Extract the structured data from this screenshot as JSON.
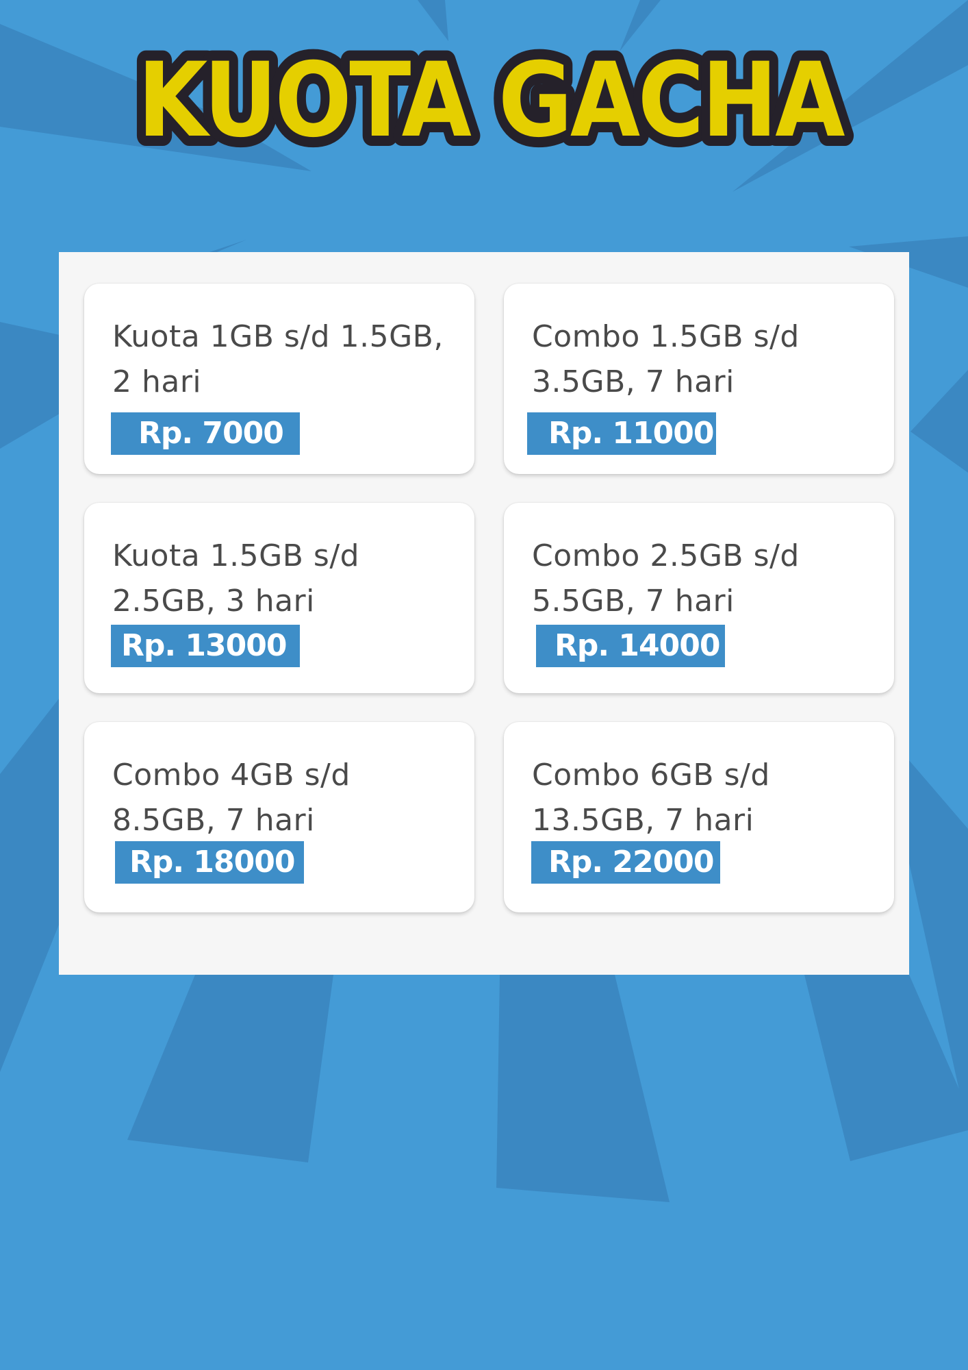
{
  "title": "KUOTA GACHA",
  "colors": {
    "background": "#449bd6",
    "background_ray": "#3b88c2",
    "title_fill": "#e5cf00",
    "title_outline": "#25212a",
    "panel": "#f6f6f6",
    "card": "#ffffff",
    "price_tag": "#3e8ec8",
    "price_text": "#ffffff",
    "desc_text": "#4a4a4a"
  },
  "packages": [
    {
      "line1": "Kuota 1GB s/d 1.5GB,",
      "line2": "2 hari",
      "price": "Rp. 7000"
    },
    {
      "line1": "Combo 1.5GB s/d",
      "line2": "3.5GB, 7 hari",
      "price": "Rp. 11000"
    },
    {
      "line1": "Kuota 1.5GB s/d",
      "line2": "2.5GB, 3 hari",
      "price": "Rp. 13000"
    },
    {
      "line1": "Combo 2.5GB s/d",
      "line2": "5.5GB, 7 hari",
      "price": "Rp. 14000"
    },
    {
      "line1": "Combo 4GB s/d",
      "line2": "8.5GB, 7 hari",
      "price": "Rp. 18000"
    },
    {
      "line1": "Combo 6GB s/d",
      "line2": "13.5GB, 7 hari",
      "price": "Rp. 22000"
    }
  ]
}
